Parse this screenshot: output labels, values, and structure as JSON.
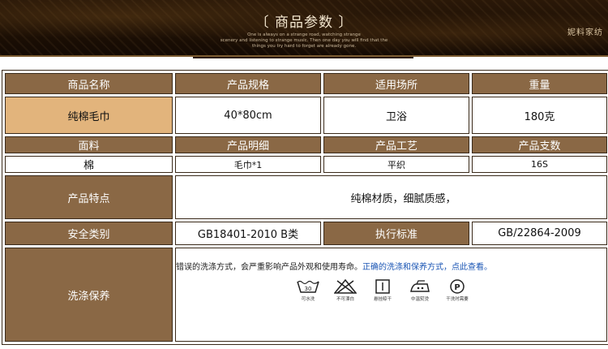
{
  "banner": {
    "title": "〔 商品参数 〕",
    "subtitle_line1": "One is always on a strange road, watching strange",
    "subtitle_line2": "scenery and listening to strange music. Then one day you will find that the",
    "subtitle_line3": "things you try hard to forget are already gone.",
    "brand": "妮料家纺"
  },
  "table": {
    "row1": {
      "h1": "商品名称",
      "h2": "产品规格",
      "h3": "适用场所",
      "h4": "重量"
    },
    "row2": {
      "v1": "纯棉毛巾",
      "v2": "40*80cm",
      "v3": "卫浴",
      "v4": "180克"
    },
    "row3": {
      "h1": "面料",
      "h2": "产品明细",
      "h3": "产品工艺",
      "h4": "产品支数"
    },
    "row4": {
      "v1": "棉",
      "v2": "毛巾*1",
      "v3": "平织",
      "v4": "16S"
    },
    "features": {
      "label": "产品特点",
      "text": "纯棉材质，细腻质感，"
    },
    "safety": {
      "label": "安全类别",
      "value": "GB18401-2010  B类",
      "std_label": "执行标准",
      "std_value": "GB/22864-2009"
    },
    "care": {
      "label": "洗涤保养",
      "text": "错误的洗涤方式，会严重影响产品外观和使用寿命。",
      "link": "正确的洗涤和保养方式，点此查看。",
      "icons": [
        {
          "icon": "wash-30-icon",
          "label": "可水洗",
          "temp": "30"
        },
        {
          "icon": "no-bleach-icon",
          "label": "不可漂白"
        },
        {
          "icon": "hang-dry-icon",
          "label": "悬挂晾干"
        },
        {
          "icon": "iron-medium-icon",
          "label": "中温熨烫"
        },
        {
          "icon": "dry-clean-icon",
          "label": "干洗时需要",
          "letter": "P"
        }
      ]
    }
  }
}
